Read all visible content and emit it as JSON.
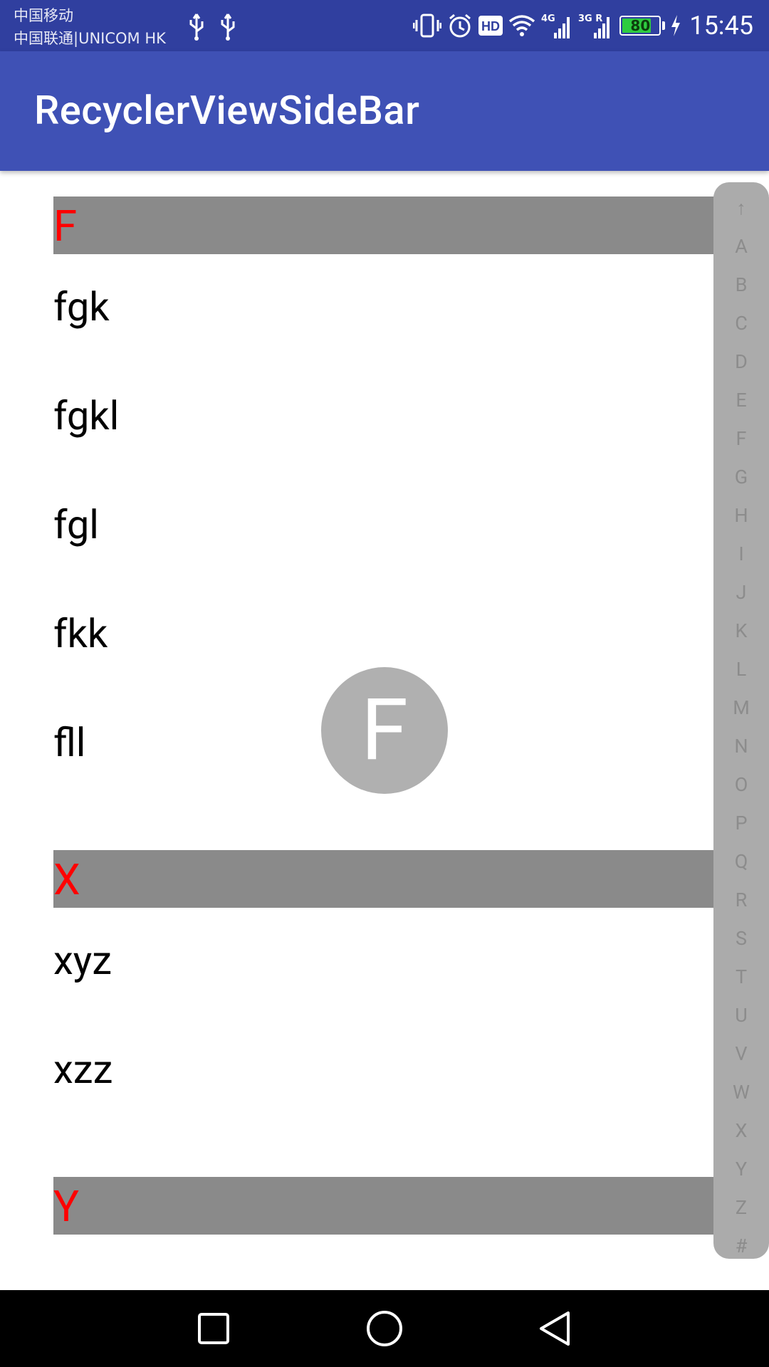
{
  "status_bar": {
    "carrier_1": "中国移动",
    "carrier_2": "中国联通|UNICOM HK",
    "battery_level": "80",
    "battery_fraction": 0.8,
    "time": "15:45",
    "network_1": "4G",
    "network_2": "3G R",
    "hd_badge": "HD",
    "icons": [
      "usb-icon",
      "usb-icon",
      "vibrate-icon",
      "alarm-icon",
      "hd-icon",
      "wifi-icon",
      "signal-icon",
      "signal-icon",
      "battery-icon",
      "charging-icon"
    ]
  },
  "app_bar": {
    "title": "RecyclerViewSideBar"
  },
  "list": {
    "rows": [
      {
        "type": "header",
        "text": "F"
      },
      {
        "type": "item",
        "text": "fgk"
      },
      {
        "type": "item",
        "text": "fgkl"
      },
      {
        "type": "item",
        "text": "fgl"
      },
      {
        "type": "item",
        "text": "fkk"
      },
      {
        "type": "item",
        "text": "fll"
      },
      {
        "type": "header",
        "text": "X"
      },
      {
        "type": "item",
        "text": "xyz"
      },
      {
        "type": "item",
        "text": "xzz"
      },
      {
        "type": "header",
        "text": "Y"
      }
    ]
  },
  "sidebar": {
    "indexes": [
      "↑",
      "A",
      "B",
      "C",
      "D",
      "E",
      "F",
      "G",
      "H",
      "I",
      "J",
      "K",
      "L",
      "M",
      "N",
      "O",
      "P",
      "Q",
      "R",
      "S",
      "T",
      "U",
      "V",
      "W",
      "X",
      "Y",
      "Z",
      "#"
    ]
  },
  "overlay": {
    "letter": "F"
  },
  "nav_bar": {
    "buttons": [
      "recents-icon",
      "home-icon",
      "back-icon"
    ]
  },
  "colors": {
    "status_bar": "#303f9f",
    "app_bar": "#3f51b5",
    "header_bg": "#8a8a8a",
    "header_text": "#ff0000",
    "sidebar_bg": "#ababab",
    "overlay_bg": "#b0b0b0"
  }
}
